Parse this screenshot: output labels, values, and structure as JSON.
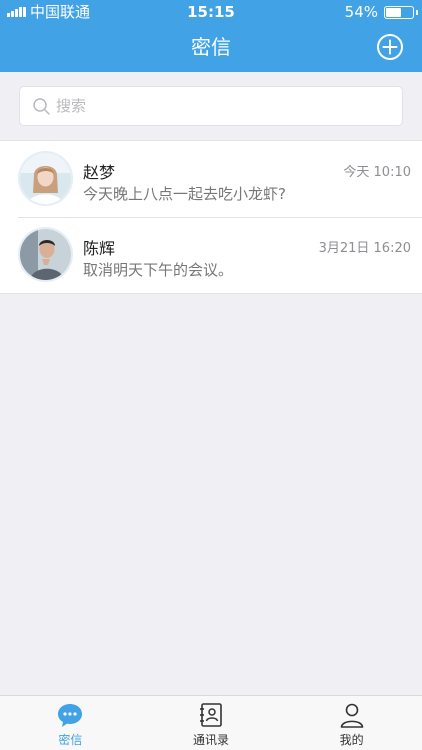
{
  "status_bar": {
    "carrier": "中国联通",
    "time": "15:15",
    "battery_percent": "54%",
    "battery_level": 0.54
  },
  "nav": {
    "title": "密信",
    "add_icon": "plus-circle-icon"
  },
  "search": {
    "placeholder": "搜索",
    "value": ""
  },
  "messages": [
    {
      "name": "赵梦",
      "preview": "今天晚上八点一起去吃小龙虾?",
      "timestamp": "今天  10:10",
      "avatar": "female-avatar"
    },
    {
      "name": "陈辉",
      "preview": "取消明天下午的会议。",
      "timestamp": "3月21日  16:20",
      "avatar": "male-avatar"
    }
  ],
  "tabs": [
    {
      "label": "密信",
      "icon": "chat-bubble-icon",
      "active": true
    },
    {
      "label": "通讯录",
      "icon": "contacts-book-icon",
      "active": false
    },
    {
      "label": "我的",
      "icon": "person-icon",
      "active": false
    }
  ],
  "colors": {
    "brand": "#41a2e6",
    "background": "#efeff4"
  }
}
